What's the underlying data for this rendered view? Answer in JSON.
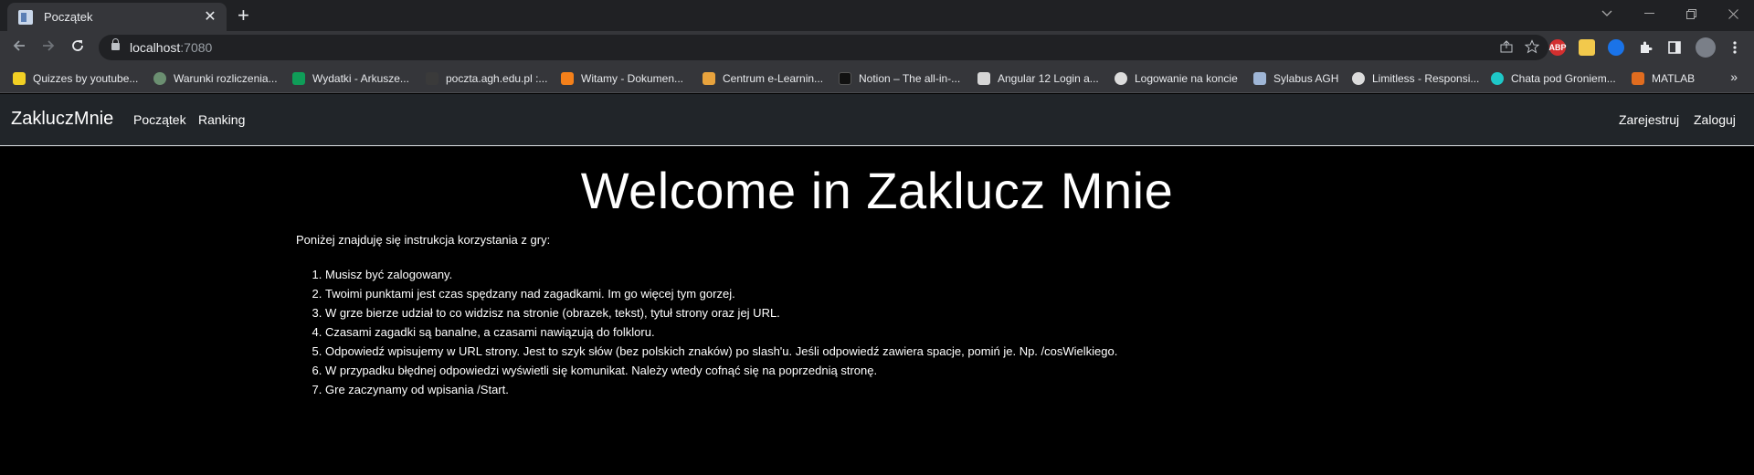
{
  "browser": {
    "tab_title": "Początek",
    "tab_close": "✕",
    "new_tab": "+",
    "url_host": "localhost",
    "url_port": ":7080",
    "bookmarks": [
      {
        "label": "Quizzes by youtube...",
        "color": "#f2d024"
      },
      {
        "label": "Warunki rozliczenia...",
        "color": "#6b8f71"
      },
      {
        "label": "Wydatki - Arkusze...",
        "color": "#0f9d58"
      },
      {
        "label": "poczta.agh.edu.pl :...",
        "color": "#3a3a3a"
      },
      {
        "label": "Witamy - Dokumen...",
        "color": "#f4801a"
      },
      {
        "label": "Centrum e-Learnin...",
        "color": "#e8a33d"
      },
      {
        "label": "Notion – The all-in-...",
        "color": "#111111"
      },
      {
        "label": "Angular 12 Login a...",
        "color": "#d6d6d6"
      },
      {
        "label": "Logowanie na koncie",
        "color": "#dcdcdc"
      },
      {
        "label": "Sylabus AGH",
        "color": "#9fb6d6"
      },
      {
        "label": "Limitless - Responsi...",
        "color": "#dcdcdc"
      },
      {
        "label": "Chata pod Groniem...",
        "color": "#1ec8c8"
      },
      {
        "label": "MATLAB",
        "color": "#e06c1f"
      }
    ],
    "extensions": [
      {
        "label": "ABP",
        "color": "#d32f2f"
      },
      {
        "label": "",
        "color": "#f2c94c"
      },
      {
        "label": "",
        "color": "#1a73e8"
      }
    ]
  },
  "navbar": {
    "brand": "ZakluczMnie",
    "links": [
      "Początek",
      "Ranking"
    ],
    "right_links": [
      "Zarejestruj",
      "Zaloguj"
    ]
  },
  "content": {
    "title": "Welcome in Zaklucz Mnie",
    "intro": "Poniżej znajduję się instrukcja korzystania z gry:",
    "steps": [
      "Musisz być zalogowany.",
      "Twoimi punktami jest czas spędzany nad zagadkami. Im go więcej tym gorzej.",
      "W grze bierze udział to co widzisz na stronie (obrazek, tekst), tytuł strony oraz jej URL.",
      "Czasami zagadki są banalne, a czasami nawiązują do folkloru.",
      "Odpowiedź wpisujemy w URL strony. Jest to szyk słów (bez polskich znaków) po slash'u. Jeśli odpowiedź zawiera spacje, pomiń je. Np. /cosWielkiego.",
      "W przypadku błędnej odpowiedzi wyświetli się komunikat. Należy wtedy cofnąć się na poprzednią stronę.",
      "Gre zaczynamy od wpisania /Start."
    ]
  }
}
